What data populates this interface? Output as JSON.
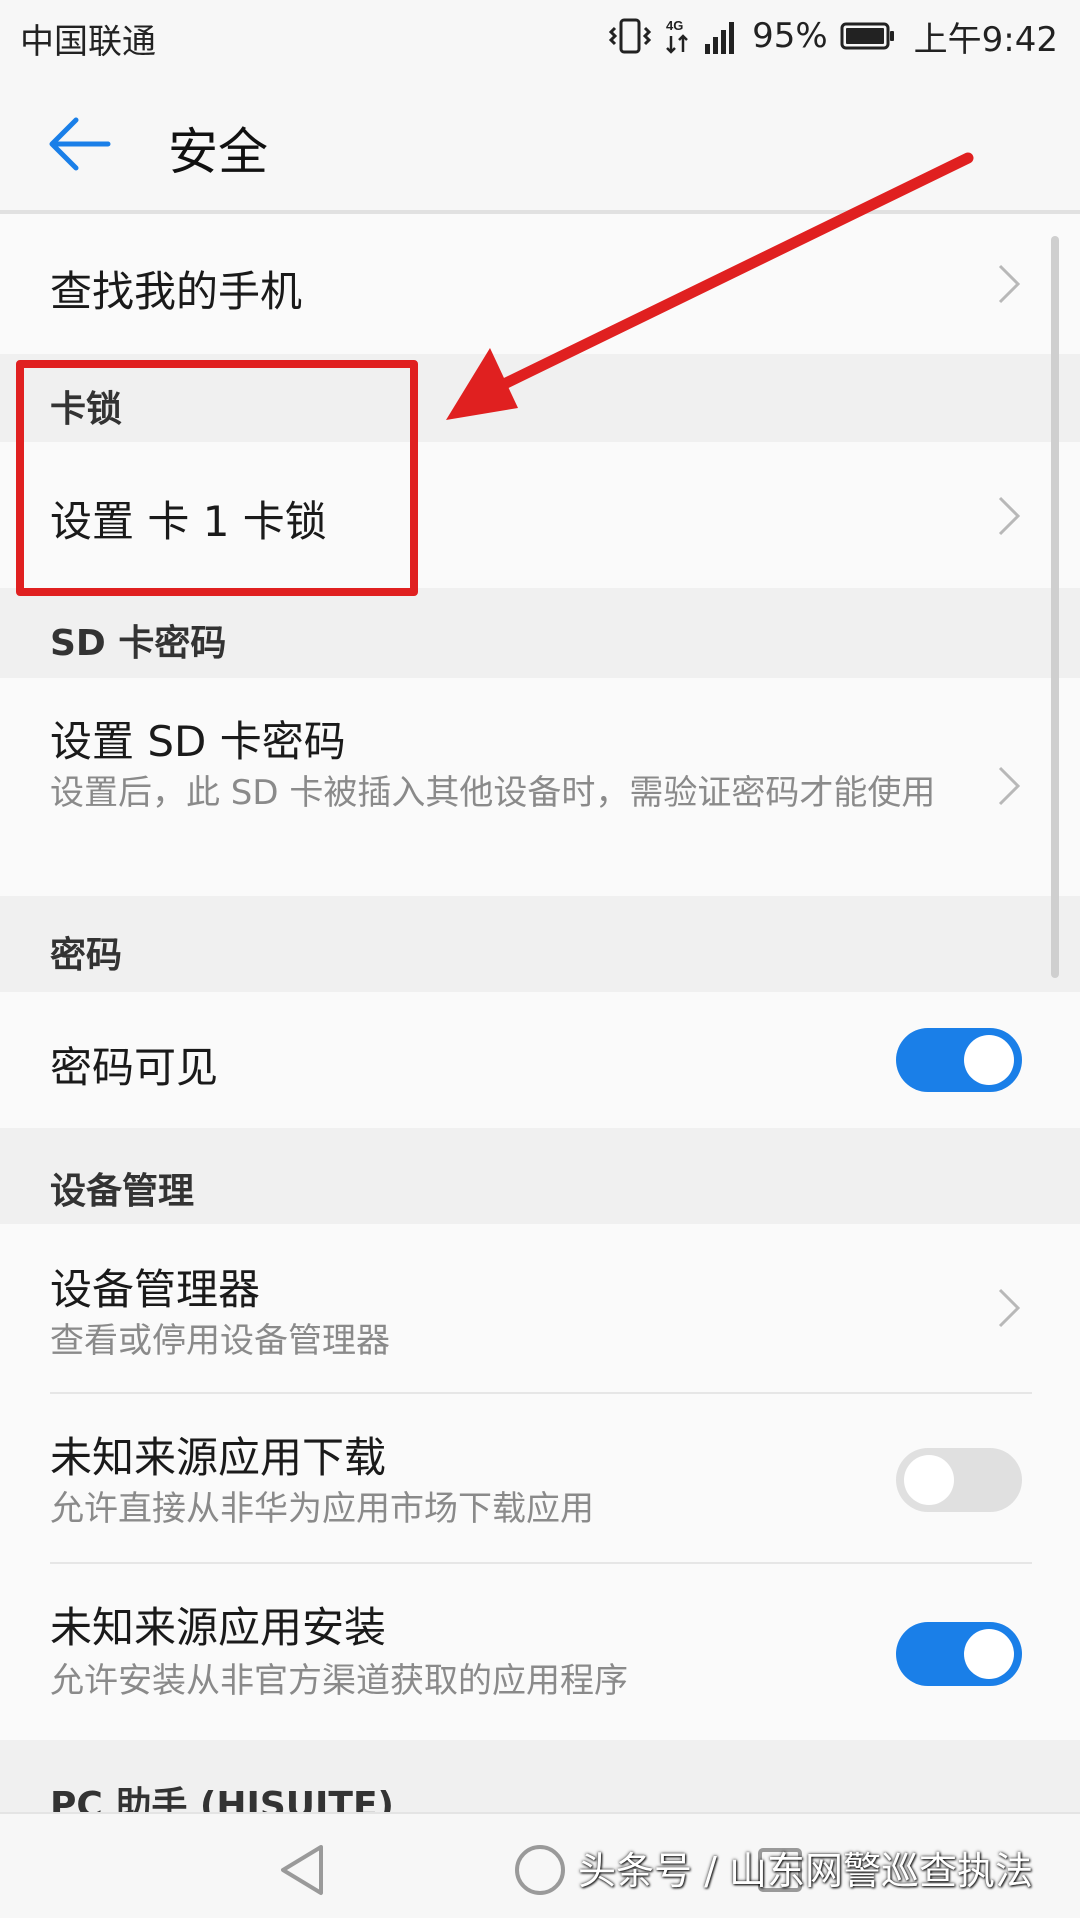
{
  "status_bar": {
    "carrier": "中国联通",
    "network": "4G",
    "battery": "95%",
    "time": "上午9:42"
  },
  "app_bar": {
    "title": "安全"
  },
  "sections": {
    "find_phone": {
      "title": "查找我的手机"
    },
    "card_lock": {
      "header": "卡锁",
      "item_title": "设置 卡 1 卡锁"
    },
    "sd_password": {
      "header": "SD 卡密码",
      "item_title": "设置 SD 卡密码",
      "item_sub": "设置后，此 SD 卡被插入其他设备时，需验证密码才能使用"
    },
    "password": {
      "header": "密码",
      "item_title": "密码可见",
      "toggle_on": true
    },
    "device_admin": {
      "header": "设备管理",
      "items": [
        {
          "title": "设备管理器",
          "sub": "查看或停用设备管理器"
        },
        {
          "title": "未知来源应用下载",
          "sub": "允许直接从非华为应用市场下载应用",
          "toggle_on": false
        },
        {
          "title": "未知来源应用安装",
          "sub": "允许安装从非官方渠道获取的应用程序",
          "toggle_on": true
        }
      ]
    },
    "pc_assistant": {
      "header": "PC 助手 (HISUITE)"
    }
  },
  "watermark": "头条号 / 山东网警巡查执法",
  "colors": {
    "accent": "#1a7fe8",
    "annotation": "#e02020"
  },
  "icons": {
    "back": "arrow-left-icon",
    "chevron": "chevron-right-icon",
    "nav_back": "triangle-back-icon",
    "nav_home": "circle-home-icon",
    "nav_recent": "square-recent-icon"
  }
}
